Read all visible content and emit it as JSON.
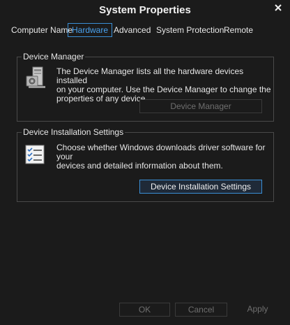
{
  "window": {
    "title": "System Properties"
  },
  "tabs": [
    {
      "label": "Computer Name"
    },
    {
      "label": "Hardware"
    },
    {
      "label": "Advanced"
    },
    {
      "label": "System Protection"
    },
    {
      "label": "Remote"
    }
  ],
  "device_manager": {
    "legend": "Device Manager",
    "description_lines": [
      "The Device Manager lists all the hardware devices installed",
      "on your computer. Use the Device Manager to change the",
      "properties of any device."
    ],
    "button_label": "Device Manager",
    "button_enabled": false
  },
  "device_installation": {
    "legend": "Device Installation Settings",
    "description_lines": [
      "Choose whether Windows downloads driver software for your",
      "devices and detailed information about them."
    ],
    "button_label": "Device Installation Settings"
  },
  "footer": {
    "ok_label": "OK",
    "cancel_label": "Cancel",
    "apply_label": "Apply"
  },
  "colors": {
    "accent": "#3a8fd6",
    "background": "#1b1b1b",
    "disabled_text": "#6f6f6f"
  },
  "icons": {
    "close": "close-icon",
    "device_manager": "device-manager-icon",
    "installation_settings": "checklist-icon"
  }
}
